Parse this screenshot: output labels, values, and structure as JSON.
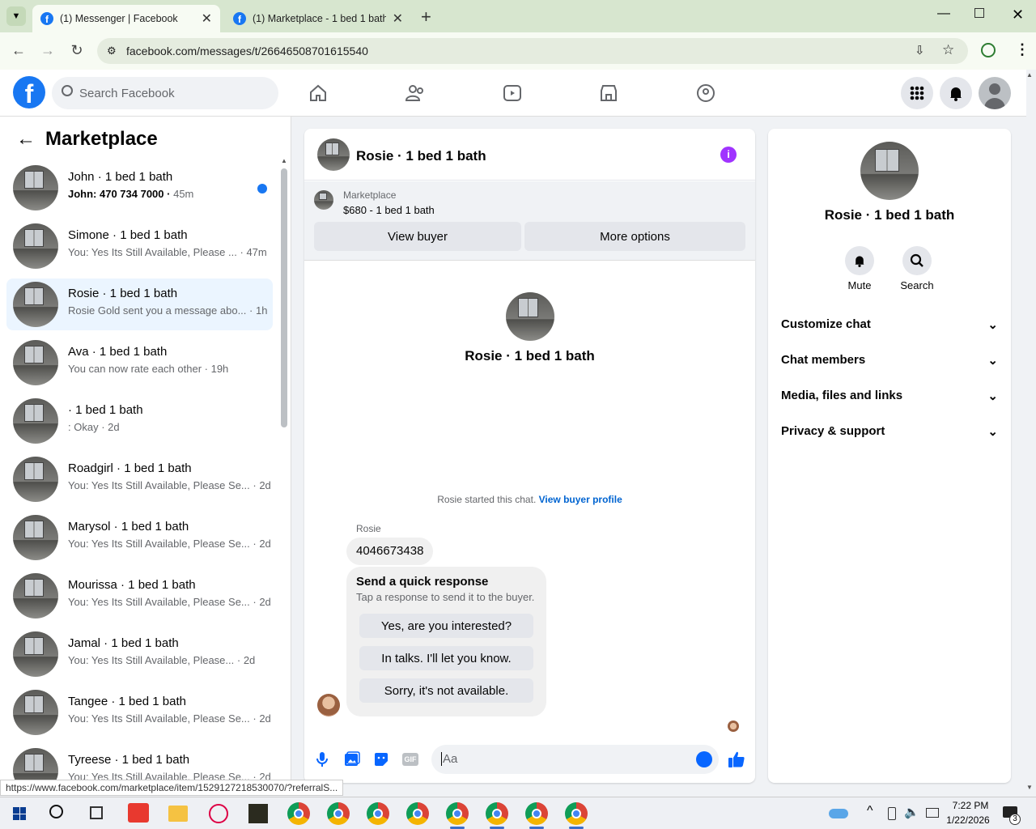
{
  "browser": {
    "tabs": [
      {
        "title": "(1) Messenger | Facebook",
        "active": true
      },
      {
        "title": "(1) Marketplace - 1 bed 1 bath",
        "active": false
      }
    ],
    "url": "facebook.com/messages/t/26646508701615540",
    "status_url": "https://www.facebook.com/marketplace/item/1529127218530070/?referralS..."
  },
  "fb": {
    "search_placeholder": "Search Facebook",
    "nav_icons": [
      "home-icon",
      "friends-icon",
      "video-icon",
      "marketplace-icon",
      "groups-icon"
    ],
    "accent": "#1877f2"
  },
  "left": {
    "title": "Marketplace",
    "conversations": [
      {
        "name": "John · 1 bed 1 bath",
        "snippet": "John: 470 734 7000",
        "time": "45m",
        "unread": true
      },
      {
        "name": "Simone · 1 bed 1 bath",
        "snippet": "You: Yes Its Still Available, Please ...",
        "time": "47m"
      },
      {
        "name": "Rosie · 1 bed 1 bath",
        "snippet": "Rosie Gold sent you a message abo...",
        "time": "1h",
        "selected": true
      },
      {
        "name": "Ava · 1 bed 1 bath",
        "snippet": "You can now rate each other",
        "time": "19h"
      },
      {
        "name": "· 1 bed 1 bath",
        "snippet": ": Okay",
        "time": "2d"
      },
      {
        "name": "Roadgirl · 1 bed 1 bath",
        "snippet": "You: Yes Its Still Available, Please Se...",
        "time": "2d"
      },
      {
        "name": "Marysol · 1 bed 1 bath",
        "snippet": "You: Yes Its Still Available, Please Se...",
        "time": "2d"
      },
      {
        "name": "Mourissa · 1 bed 1 bath",
        "snippet": "You: Yes Its Still Available, Please Se...",
        "time": "2d"
      },
      {
        "name": "Jamal · 1 bed 1 bath",
        "snippet": "You: Yes Its Still Available, Please...",
        "time": "2d"
      },
      {
        "name": "Tangee · 1 bed 1 bath",
        "snippet": "You: Yes Its Still Available, Please Se...",
        "time": "2d"
      },
      {
        "name": "Tyreese · 1 bed 1 bath",
        "snippet": "You: Yes Its Still Available, Please Se...",
        "time": "2d"
      }
    ]
  },
  "chat": {
    "title": "Rosie · 1 bed 1 bath",
    "marketplace_label": "Marketplace",
    "listing": "$680 - 1 bed 1 bath",
    "view_buyer": "View buyer",
    "more_options": "More options",
    "center_name": "Rosie · 1 bed 1 bath",
    "started_text": "Rosie started this chat.",
    "view_buyer_profile": "View buyer profile",
    "sender": "Rosie",
    "message": "4046673438",
    "quick_title": "Send a quick response",
    "quick_sub": "Tap a response to send it to the buyer.",
    "quick_responses": [
      "Yes, are you interested?",
      "In talks. I'll let you know.",
      "Sorry, it's not available."
    ],
    "composer_placeholder": "Aa"
  },
  "right": {
    "name": "Rosie · 1 bed 1 bath",
    "mute": "Mute",
    "search": "Search",
    "sections": [
      "Customize chat",
      "Chat members",
      "Media, files and links",
      "Privacy & support"
    ]
  },
  "taskbar": {
    "time": "7:22 PM",
    "date": "1/22/2026",
    "notif_count": "3"
  }
}
